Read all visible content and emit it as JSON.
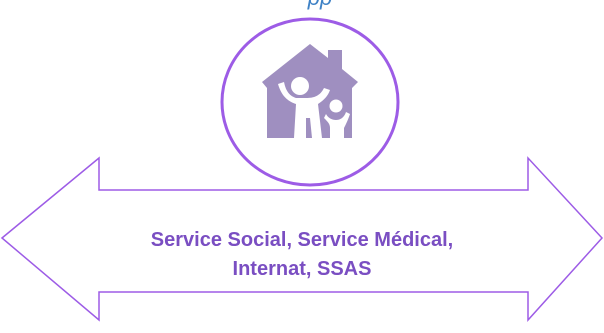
{
  "header": {
    "partial_text": "pp"
  },
  "house_icon": {
    "name": "family-house-icon",
    "color": "#9f8fc0"
  },
  "circle": {
    "stroke_color": "#9d5ce6",
    "fill_color": "#ffffff"
  },
  "arrow": {
    "stroke_color": "#9d5ce6",
    "fill_color": "#ffffff",
    "label_line1": "Service Social, Service Médical,",
    "label_line2": "Internat, SSAS",
    "label_color": "#7a4ec2"
  }
}
